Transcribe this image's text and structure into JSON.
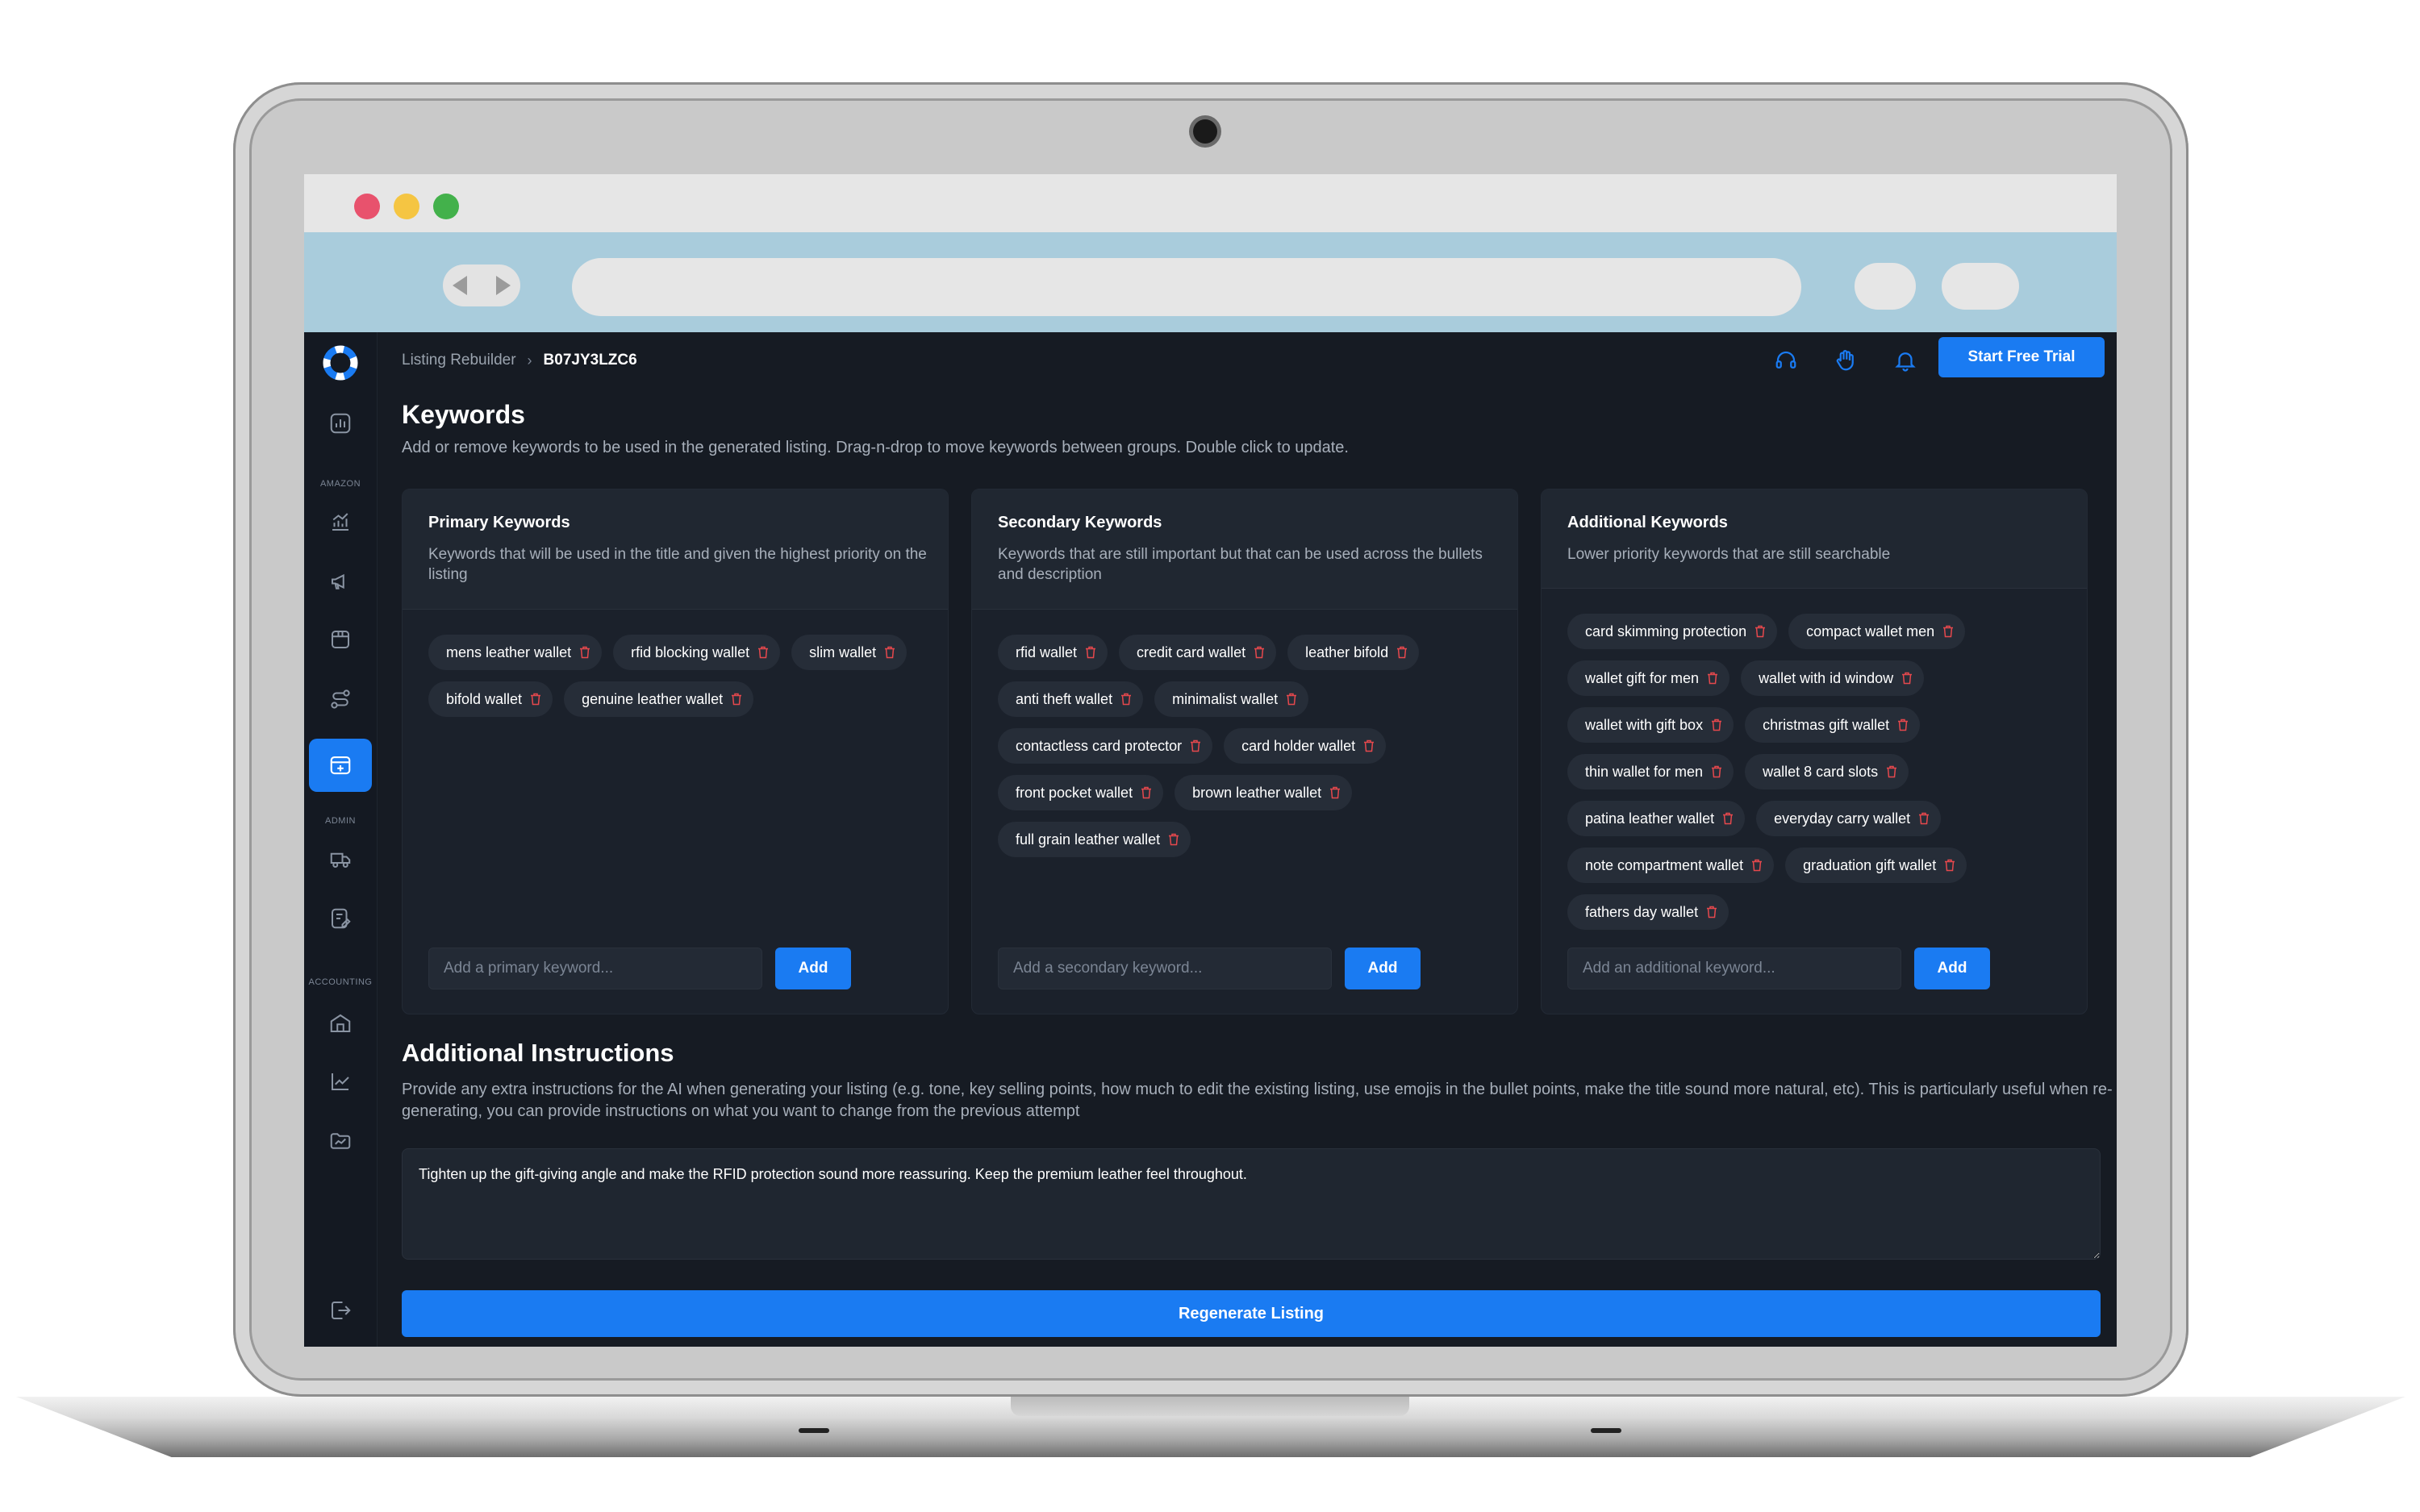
{
  "app": {
    "breadcrumb": {
      "parent": "Listing Rebuilder",
      "separator": "›",
      "current": "B07JY3LZC6"
    },
    "header": {
      "trial_button": "Start Free Trial"
    },
    "sidebar": {
      "section_amazon": "AMAZON",
      "section_admin": "ADMIN",
      "section_accounting": "ACCOUNTING"
    },
    "page": {
      "title": "Keywords",
      "subtitle": "Add or remove keywords to be used in the generated listing. Drag-n-drop to move keywords between groups. Double click to update."
    },
    "panels": [
      {
        "title": "Primary Keywords",
        "description": "Keywords that will be used in the title and given the highest priority on the listing",
        "keywords": [
          "mens leather wallet",
          "rfid blocking wallet",
          "slim wallet",
          "bifold wallet",
          "genuine leather wallet"
        ],
        "input_placeholder": "Add a primary keyword...",
        "add_label": "Add"
      },
      {
        "title": "Secondary Keywords",
        "description": "Keywords that are still important but that can be used across the bullets and description",
        "keywords": [
          "rfid wallet",
          "credit card wallet",
          "leather bifold",
          "anti theft wallet",
          "minimalist wallet",
          "contactless card protector",
          "card holder wallet",
          "front pocket wallet",
          "brown leather wallet",
          "full grain leather wallet"
        ],
        "input_placeholder": "Add a secondary keyword...",
        "add_label": "Add"
      },
      {
        "title": "Additional Keywords",
        "description": "Lower priority keywords that are still searchable",
        "keywords": [
          "card skimming protection",
          "compact wallet men",
          "wallet gift for men",
          "wallet with id window",
          "wallet with gift box",
          "christmas gift wallet",
          "thin wallet for men",
          "wallet 8 card slots",
          "patina leather wallet",
          "everyday carry wallet",
          "note compartment wallet",
          "graduation gift wallet",
          "fathers day wallet"
        ],
        "input_placeholder": "Add an additional keyword...",
        "add_label": "Add"
      }
    ],
    "instructions": {
      "title": "Additional Instructions",
      "description": "Provide any extra instructions for the AI when generating your listing (e.g. tone, key selling points, how much to edit the existing listing, use emojis in the bullet points, make the title sound more natural, etc). This is particularly useful when re-generating, you can provide instructions on what you want to change from the previous attempt",
      "value": "Tighten up the gift-giving angle and make the RFID protection sound more reassuring. Keep the premium leather feel throughout."
    },
    "regenerate_label": "Regenerate Listing",
    "colors": {
      "accent": "#1a7bf2",
      "background": "#161b23",
      "panel": "#1b212b",
      "chip": "#262d38",
      "trash": "#e5484d"
    }
  }
}
